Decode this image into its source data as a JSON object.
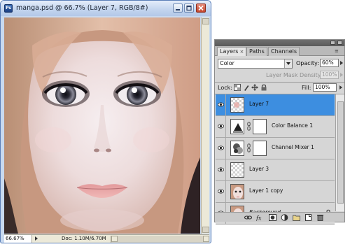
{
  "document": {
    "title": "manga.psd @ 66.7% (Layer 7, RGB/8#)",
    "zoom": "66.67%",
    "doc_info": "Doc: 1.10M/6.70M"
  },
  "panel": {
    "tabs": [
      {
        "label": "Layers",
        "close": "×"
      },
      {
        "label": "Paths"
      },
      {
        "label": "Channels"
      }
    ],
    "menu_icon": "≡",
    "blend_mode": "Color",
    "opacity_label": "Opacity:",
    "opacity_value": "60%",
    "mask_density_label": "Layer Mask Density",
    "mask_density_value": "100%",
    "lock_label": "Lock:",
    "fill_label": "Fill:",
    "fill_value": "100%",
    "layers": [
      {
        "name": "Layer 7",
        "selected": true,
        "thumb": "checker"
      },
      {
        "name": "Color Balance 1",
        "thumb": "color-balance-icon",
        "has_mask": true
      },
      {
        "name": "Channel Mixer 1",
        "thumb": "channel-mixer-icon",
        "has_mask": true
      },
      {
        "name": "Layer 3",
        "thumb": "checker"
      },
      {
        "name": "Layer 1 copy",
        "thumb": "face"
      },
      {
        "name": "Background",
        "thumb": "face",
        "locked": true,
        "italic": true
      }
    ]
  },
  "colors": {
    "selection": "#3d8ee0",
    "titlebar": "#c2d4ee",
    "panel_bg": "#d6d6d6"
  }
}
